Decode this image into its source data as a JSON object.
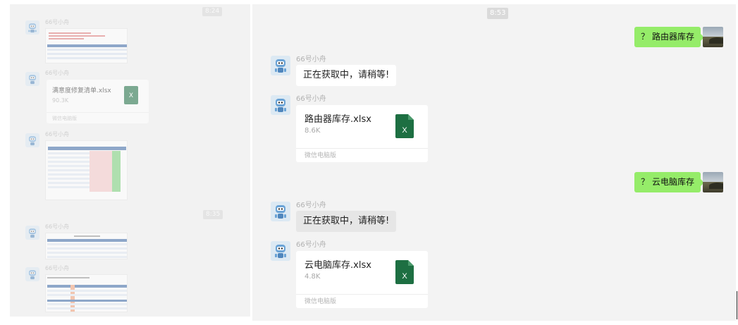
{
  "left_chat": {
    "timestamps": [
      "8:24",
      "8:35"
    ],
    "sender_name": "66号小舟",
    "file_message": {
      "filename": "满意度修复清单.xlsx",
      "size": "90.3K",
      "source": "微信电脑版",
      "icon": "excel-file-icon"
    }
  },
  "right_chat": {
    "timestamp": "8:53",
    "messages": [
      {
        "side": "me",
        "text": "？ 路由器库存"
      },
      {
        "side": "bot",
        "name": "66号小舟",
        "text": "正在获取中，请稍等!"
      },
      {
        "side": "bot",
        "name": "66号小舟",
        "file": {
          "filename": "路由器库存.xlsx",
          "size": "8.6K",
          "source": "微信电脑版",
          "icon_letter": "X"
        }
      },
      {
        "side": "me",
        "text": "？ 云电脑库存"
      },
      {
        "side": "bot",
        "name": "66号小舟",
        "text": "正在获取中，请稍等!"
      },
      {
        "side": "bot",
        "name": "66号小舟",
        "file": {
          "filename": "云电脑库存.xlsx",
          "size": "4.8K",
          "source": "微信电脑版",
          "icon_letter": "X"
        }
      }
    ]
  },
  "colors": {
    "my_bubble": "#95ec69",
    "excel_green": "#1d6f42",
    "chat_bg": "#f3f3f3"
  }
}
